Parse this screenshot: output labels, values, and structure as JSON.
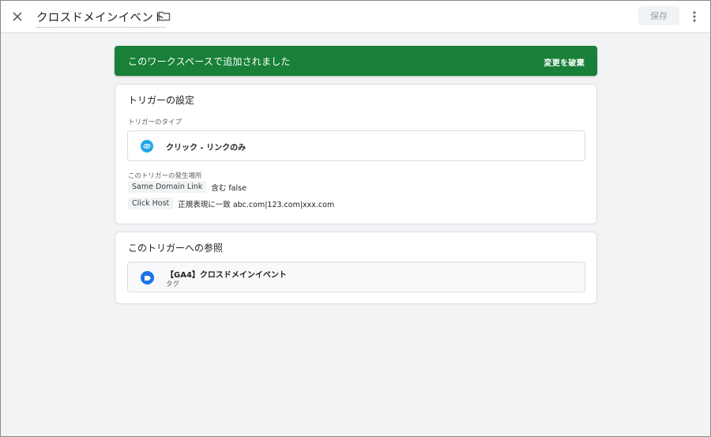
{
  "header": {
    "title": "クロスドメインイベント",
    "save_label": "保存"
  },
  "banner": {
    "message": "このワークスペースで追加されました",
    "action_label": "変更を破棄"
  },
  "trigger_config": {
    "title": "トリガーの設定",
    "type_label": "トリガーのタイプ",
    "type_name": "クリック - リンクのみ",
    "type_icon": "link-icon",
    "fires_on_label": "このトリガーの発生場所",
    "conditions": [
      {
        "variable": "Same Domain Link",
        "text": "含む false"
      },
      {
        "variable": "Click Host",
        "text": "正規表現に一致 abc.com|123.com|xxx.com"
      }
    ]
  },
  "references": {
    "title": "このトリガーへの参照",
    "items": [
      {
        "name": "【GA4】クロスドメインイベント",
        "kind": "タグ",
        "icon": "tag-icon"
      }
    ]
  },
  "colors": {
    "banner_bg": "#188038",
    "link_icon_bg": "#1ea7e8",
    "tag_icon_bg": "#1a73e8",
    "page_bg": "#f1f3f4"
  }
}
